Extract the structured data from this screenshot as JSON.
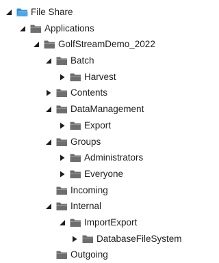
{
  "tree": {
    "root": {
      "label": "File Share",
      "icon": "shared-folder-icon",
      "state": "expanded"
    },
    "applications": {
      "label": "Applications",
      "icon": "folder-icon",
      "state": "expanded"
    },
    "golfstream": {
      "label": "GolfStreamDemo_2022",
      "icon": "folder-icon",
      "state": "expanded"
    },
    "batch": {
      "label": "Batch",
      "icon": "folder-icon",
      "state": "expanded"
    },
    "harvest": {
      "label": "Harvest",
      "icon": "folder-icon",
      "state": "collapsed"
    },
    "contents": {
      "label": "Contents",
      "icon": "folder-icon",
      "state": "collapsed"
    },
    "datamanagement": {
      "label": "DataManagement",
      "icon": "folder-icon",
      "state": "expanded"
    },
    "export": {
      "label": "Export",
      "icon": "folder-icon",
      "state": "collapsed"
    },
    "groups": {
      "label": "Groups",
      "icon": "folder-icon",
      "state": "expanded"
    },
    "administrators": {
      "label": "Administrators",
      "icon": "folder-icon",
      "state": "collapsed"
    },
    "everyone": {
      "label": "Everyone",
      "icon": "folder-icon",
      "state": "collapsed"
    },
    "incoming": {
      "label": "Incoming",
      "icon": "folder-icon",
      "state": "leaf"
    },
    "internal": {
      "label": "Internal",
      "icon": "folder-icon",
      "state": "expanded"
    },
    "importexport": {
      "label": "ImportExport",
      "icon": "folder-icon",
      "state": "expanded"
    },
    "databasefilesystem": {
      "label": "DatabaseFileSystem",
      "icon": "folder-icon",
      "state": "collapsed"
    },
    "outgoing": {
      "label": "Outgoing",
      "icon": "folder-icon",
      "state": "leaf"
    }
  },
  "colors": {
    "text": "#1e1e1e",
    "arrow": "#1e1e1e",
    "folder": "#6e6e6e",
    "shared_folder": "#2f8fd8"
  }
}
